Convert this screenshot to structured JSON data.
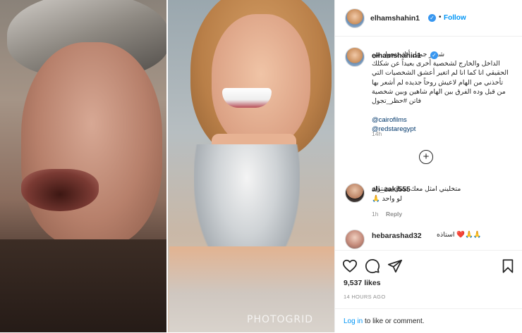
{
  "post": {
    "username": "elhamshahin1",
    "follow_label": "Follow",
    "separator": "•",
    "watermark": "PHOTOGRID"
  },
  "caption": {
    "username": "elhamshahin1",
    "text": "شعور جميل أنك تتحول من الداخل والخارج لشخصية أخرى بعيداً عن شكلك الحقيقي انا كما انا لم اتغير أعشق الشخصيات التي تأخذني من الهام لاعيش روحاً جديده لم أشعر بها من قبل وده الفرق بين الهام شاهين وبين شخصية فاتن #حظر_تجول",
    "tag1": "@cairofilms",
    "tag2": "@redstaregypt",
    "time": "14h"
  },
  "comments": [
    {
      "username": "ali_zaki555",
      "text": "متخليني امثل معك بعمل مشترك لو واحد 🙏",
      "time": "1h",
      "reply_label": "Reply"
    },
    {
      "username": "hebarashad32",
      "text": "استاذه ❤️🙏🙏"
    }
  ],
  "actions": {
    "likes": "9,537 likes",
    "date": "14 HOURS AGO"
  },
  "login": {
    "link": "Log in",
    "rest": " to like or comment."
  },
  "icons": {
    "like": "heart-icon",
    "comment": "comment-icon",
    "share": "share-icon",
    "save": "bookmark-icon",
    "verified": "verified-badge-icon",
    "load_more": "plus-circle-icon"
  },
  "colors": {
    "link": "#0095f6",
    "verified": "#3897f0",
    "muted": "#8e8e8e",
    "text": "#262626"
  }
}
